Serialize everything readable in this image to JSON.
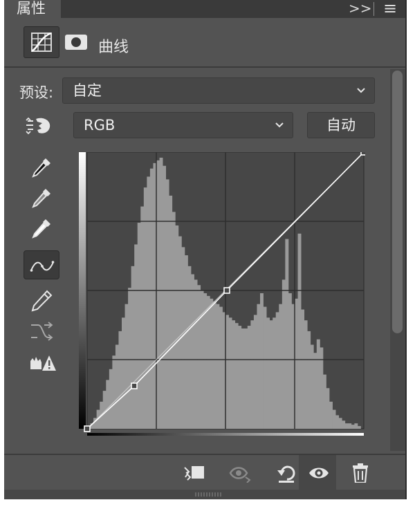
{
  "panel": {
    "tab_title": "属性",
    "collapse_glyph": ">>",
    "menu_glyph": "≡"
  },
  "header": {
    "title": "曲线"
  },
  "preset": {
    "label": "预设:",
    "value": "自定"
  },
  "channel": {
    "value": "RGB"
  },
  "auto_button": {
    "label": "自动"
  },
  "icons": {
    "tools": [
      "on-image-adjust-icon",
      "black-point-eyedropper-icon",
      "gray-point-eyedropper-icon",
      "white-point-eyedropper-icon",
      "curve-point-tool-icon",
      "pencil-icon",
      "smooth-curve-icon",
      "clipping-warning-icon"
    ],
    "bottom": [
      "clip-to-layer-icon",
      "view-previous-state-icon",
      "reset-icon",
      "visibility-eye-icon",
      "trash-icon"
    ]
  },
  "colors": {
    "panel_bg": "#535353",
    "graph_bg": "#474747",
    "histogram": "#9a9a9a",
    "grid": "#2f2f2f",
    "curve": "#ffffff"
  },
  "curve_points": [
    {
      "input": 0,
      "output": 0
    },
    {
      "input": 0.17,
      "output": 0.155
    },
    {
      "input": 0.505,
      "output": 0.5
    },
    {
      "input": 1,
      "output": 1
    }
  ],
  "histogram": [
    0.0,
    0.02,
    0.04,
    0.07,
    0.1,
    0.14,
    0.18,
    0.22,
    0.27,
    0.31,
    0.36,
    0.41,
    0.46,
    0.52,
    0.6,
    0.68,
    0.76,
    0.82,
    0.89,
    0.93,
    0.96,
    0.98,
    0.99,
    1.0,
    0.97,
    0.92,
    0.86,
    0.8,
    0.75,
    0.71,
    0.67,
    0.64,
    0.6,
    0.57,
    0.55,
    0.53,
    0.51,
    0.5,
    0.49,
    0.48,
    0.47,
    0.46,
    0.45,
    0.43,
    0.42,
    0.41,
    0.4,
    0.39,
    0.38,
    0.37,
    0.37,
    0.38,
    0.4,
    0.42,
    0.46,
    0.5,
    0.45,
    0.41,
    0.4,
    0.41,
    0.43,
    0.46,
    0.55,
    0.7,
    0.5,
    0.46,
    0.48,
    0.72,
    0.44,
    0.4,
    0.36,
    0.31,
    0.28,
    0.33,
    0.3,
    0.2,
    0.15,
    0.1,
    0.07,
    0.05,
    0.04,
    0.03,
    0.02,
    0.02,
    0.015,
    0.02,
    0.01,
    0.0
  ]
}
